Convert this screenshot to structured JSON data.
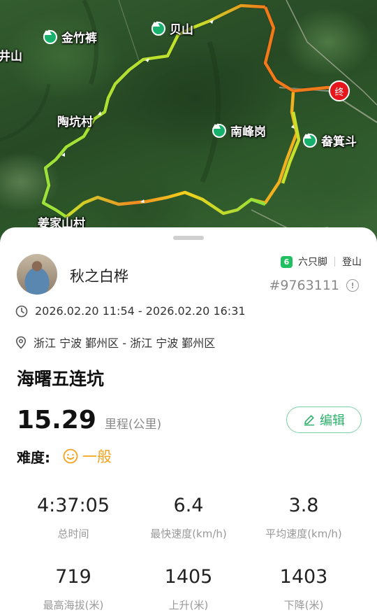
{
  "map": {
    "place_labels": [
      "金竹裤",
      "贝山",
      "井山",
      "陶坑村",
      "南峰岗",
      "畚箕斗",
      "姜家山村"
    ],
    "end_marker": "终",
    "peak_icon": "mountain-pin-icon",
    "route_colors": {
      "slow": "#8be23c",
      "mid": "#f3d21c",
      "fast": "#f07a1a"
    }
  },
  "user": {
    "name": "秋之白桦",
    "avatar": "avatar-photo"
  },
  "source": {
    "app": "六只脚",
    "activity": "登山",
    "record_id": "#9763111"
  },
  "time_range": "2026.02.20 11:54 - 2026.02.20 16:31",
  "location": "浙江 宁波 鄞州区 - 浙江 宁波 鄞州区",
  "trail_title": "海曙五连坑",
  "distance": {
    "value": "15.29",
    "unit": "里程(公里)"
  },
  "edit_label": "编辑",
  "difficulty": {
    "label": "难度:",
    "value": "一般"
  },
  "stats": [
    {
      "value": "4:37:05",
      "label": "总时间"
    },
    {
      "value": "6.4",
      "label": "最快速度(km/h)"
    },
    {
      "value": "3.8",
      "label": "平均速度(km/h)"
    },
    {
      "value": "719",
      "label": "最高海拔(米)"
    },
    {
      "value": "1405",
      "label": "上升(米)"
    },
    {
      "value": "1403",
      "label": "下降(米)"
    }
  ],
  "accent_color": "#2bb06a"
}
